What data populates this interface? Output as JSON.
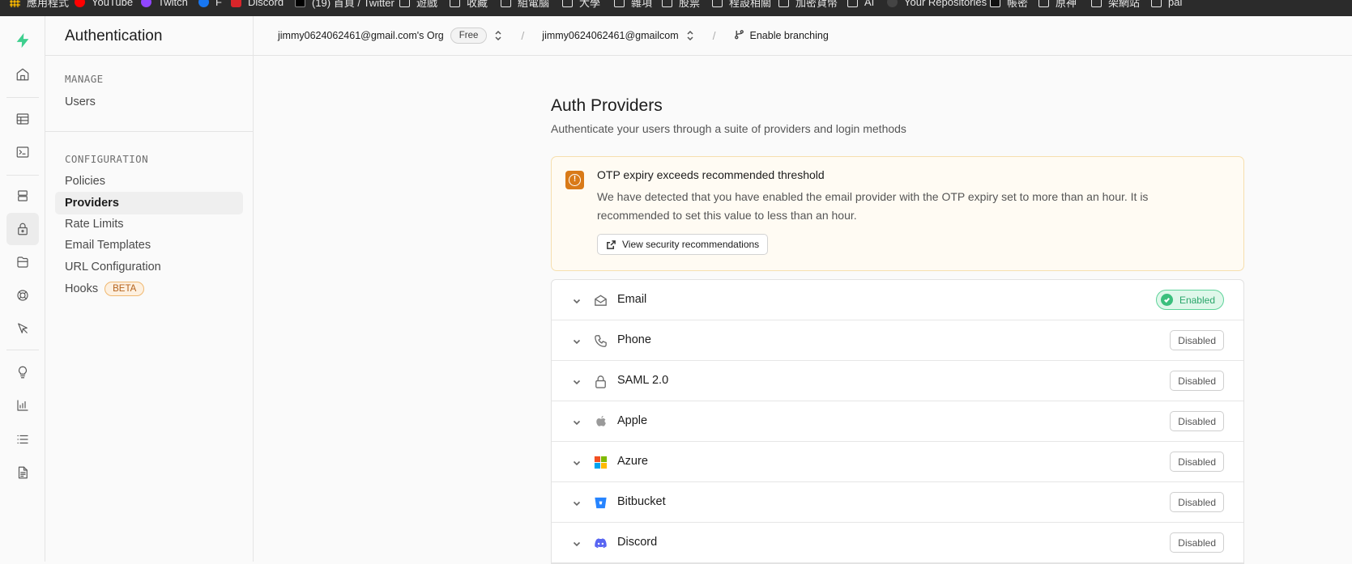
{
  "bookmarks": [
    {
      "label": "應用程式",
      "icon": "apps-grid-icon"
    },
    {
      "label": "YouTube",
      "icon": "youtube-icon"
    },
    {
      "label": "Twitch",
      "icon": "twitch-icon"
    },
    {
      "label": "F",
      "icon": "facebook-icon"
    },
    {
      "label": "Discord",
      "icon": "discord-icon"
    },
    {
      "label": "(19) 首頁 / Twitter",
      "icon": "x-icon"
    },
    {
      "label": "遊戲",
      "icon": "folder-icon"
    },
    {
      "label": "收藏",
      "icon": "folder-icon"
    },
    {
      "label": "組電腦",
      "icon": "folder-icon"
    },
    {
      "label": "大學",
      "icon": "folder-icon"
    },
    {
      "label": "雜項",
      "icon": "folder-icon"
    },
    {
      "label": "股票",
      "icon": "folder-icon"
    },
    {
      "label": "程設相關",
      "icon": "folder-icon"
    },
    {
      "label": "加密貨幣",
      "icon": "folder-icon"
    },
    {
      "label": "AI",
      "icon": "folder-icon"
    },
    {
      "label": "Your Repositories",
      "icon": "github-icon"
    },
    {
      "label": "帳密",
      "icon": "notion-icon"
    },
    {
      "label": "原神",
      "icon": "folder-icon"
    },
    {
      "label": "架網站",
      "icon": "folder-icon"
    },
    {
      "label": "pai",
      "icon": "folder-icon"
    }
  ],
  "rail": {
    "logo": "supabase-logo-icon",
    "icons": [
      "home-icon",
      "table-editor-icon",
      "sql-editor-icon",
      "database-icon",
      "authentication-icon",
      "storage-icon",
      "realtime-icon",
      "edge-functions-icon",
      "advisors-icon",
      "reports-icon",
      "logs-icon",
      "api-docs-icon"
    ]
  },
  "menu": {
    "title": "Authentication",
    "manage_title": "MANAGE",
    "users": "Users",
    "configuration_title": "CONFIGURATION",
    "items": [
      "Policies",
      "Providers",
      "Rate Limits",
      "Email Templates",
      "URL Configuration",
      "Hooks"
    ],
    "beta_badge": "BETA"
  },
  "topbar": {
    "org": "jimmy0624062461@gmail.com's Org",
    "plan": "Free",
    "project": "jimmy0624062461@gmailcom",
    "branching": "Enable branching",
    "separator": "/"
  },
  "page": {
    "title": "Auth Providers",
    "subtitle": "Authenticate your users through a suite of providers and login methods"
  },
  "alert": {
    "title": "OTP expiry exceeds recommended threshold",
    "body": "We have detected that you have enabled the email provider with the OTP expiry set to more than an hour. It is recommended to set this value to less than an hour.",
    "button": "View security recommendations"
  },
  "providers": [
    {
      "name": "Email",
      "status": "Enabled",
      "icon": "mail-icon"
    },
    {
      "name": "Phone",
      "status": "Disabled",
      "icon": "phone-icon"
    },
    {
      "name": "SAML 2.0",
      "status": "Disabled",
      "icon": "lock-icon"
    },
    {
      "name": "Apple",
      "status": "Disabled",
      "icon": "apple-icon"
    },
    {
      "name": "Azure",
      "status": "Disabled",
      "icon": "azure-icon"
    },
    {
      "name": "Bitbucket",
      "status": "Disabled",
      "icon": "bitbucket-icon"
    },
    {
      "name": "Discord",
      "status": "Disabled",
      "icon": "discord-icon"
    }
  ],
  "colors": {
    "brand": "#3ecf8e",
    "warning": "#d97a18",
    "enabled": "#2aa56a"
  }
}
